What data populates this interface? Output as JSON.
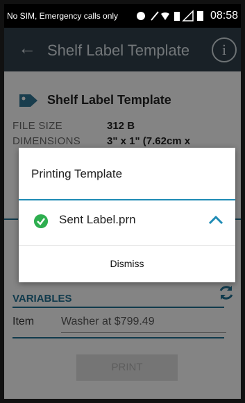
{
  "status_bar": {
    "carrier": "No SIM, Emergency calls only",
    "time": "08:58"
  },
  "app_bar": {
    "title": "Shelf Label Template",
    "info_glyph": "i"
  },
  "template": {
    "name": "Shelf Label Template",
    "file_size_label": "FILE SIZE",
    "file_size_value": "312 B",
    "dimensions_label": "DIMENSIONS",
    "dimensions_value": "3\" x 1\" (7.62cm x"
  },
  "variables": {
    "header": "VARIABLES",
    "item_label": "Item",
    "item_value": "Washer at $799.49"
  },
  "print_button": "PRINT",
  "dialog": {
    "title": "Printing Template",
    "file_status": "Sent Label.prn",
    "dismiss_label": "Dismiss"
  },
  "colors": {
    "accent": "#1e6b8b",
    "dialog_accent": "#1e8bb5",
    "success": "#2eae4f",
    "appbar": "#2f3d48"
  }
}
